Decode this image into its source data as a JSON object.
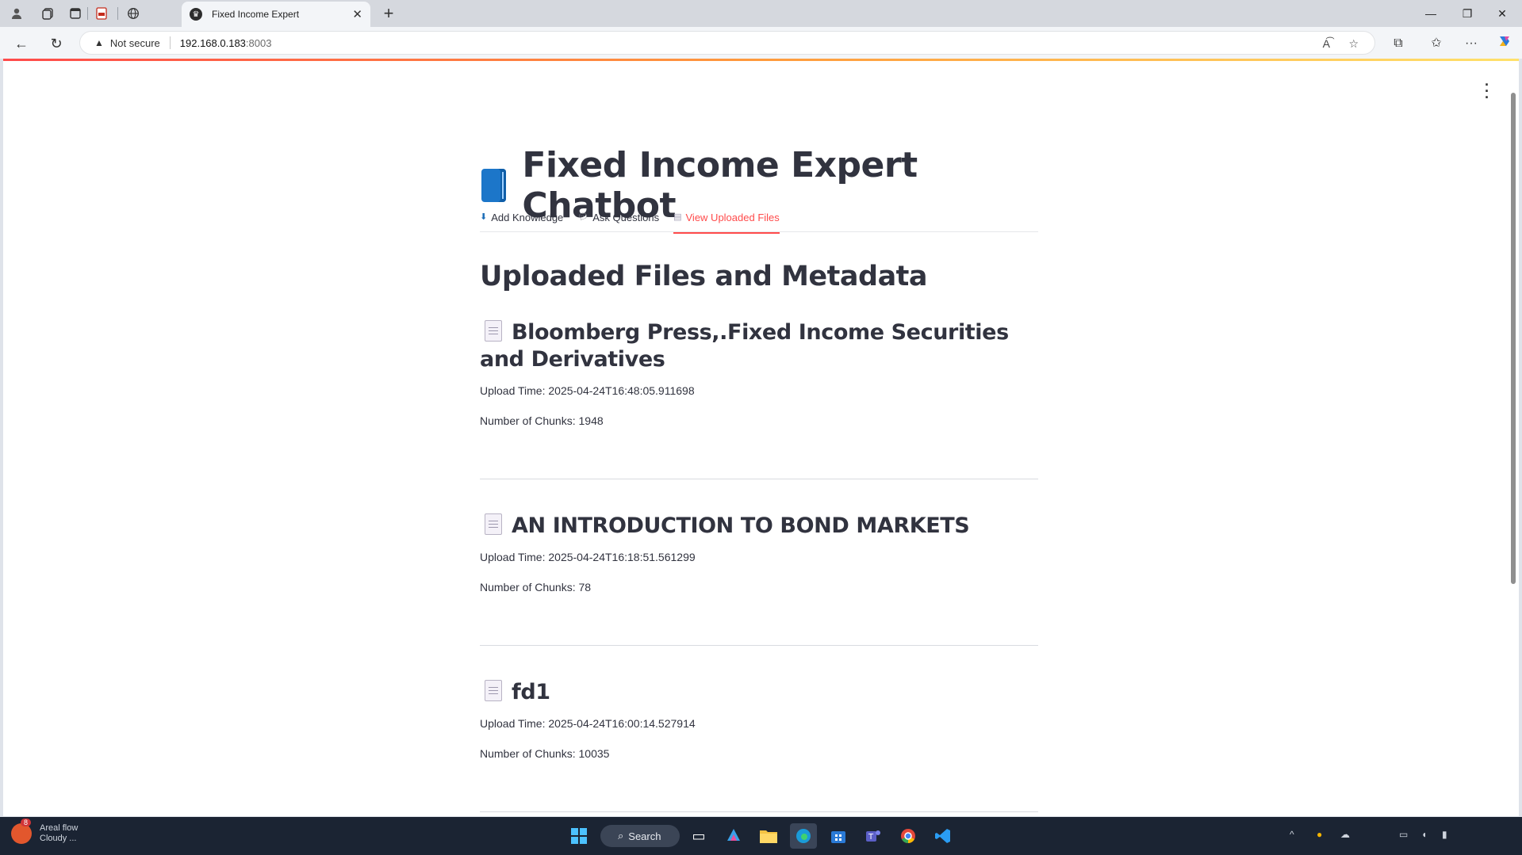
{
  "browser": {
    "tab_title": "Fixed Income Expert",
    "address_security": "Not secure",
    "address_host": "192.168.0.183",
    "address_port": ":8003"
  },
  "app": {
    "title": "Fixed Income Expert Chatbot",
    "tabs": [
      {
        "label": "Add Knowledge",
        "icon": "inbox-tray-icon",
        "active": false
      },
      {
        "label": "Ask Questions",
        "icon": "speech-bubble-icon",
        "active": false
      },
      {
        "label": "View Uploaded Files",
        "icon": "document-icon",
        "active": true
      }
    ],
    "section_title": "Uploaded Files and Metadata",
    "files": [
      {
        "name": "Bloomberg Press,.Fixed Income Securities and Derivatives",
        "upload_time": "Upload Time: 2025-04-24T16:48:05.911698",
        "chunks": "Number of Chunks: 1948"
      },
      {
        "name": "AN INTRODUCTION TO BOND MARKETS",
        "upload_time": "Upload Time: 2025-04-24T16:18:51.561299",
        "chunks": "Number of Chunks: 78"
      },
      {
        "name": "fd1",
        "upload_time": "Upload Time: 2025-04-24T16:00:14.527914",
        "chunks": "Number of Chunks: 10035"
      }
    ],
    "accent_color": "#ff4b4b"
  },
  "taskbar": {
    "search_label": "Search",
    "weather_badge": "8",
    "weather_line1": "Areal flow",
    "weather_line2": "Cloudy ..."
  }
}
